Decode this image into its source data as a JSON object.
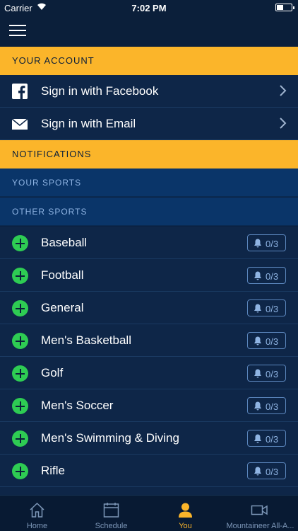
{
  "status_bar": {
    "carrier": "Carrier",
    "time": "7:02 PM"
  },
  "account": {
    "header": "YOUR ACCOUNT",
    "facebook_label": "Sign in with Facebook",
    "email_label": "Sign in with Email"
  },
  "notifications": {
    "header": "NOTIFICATIONS",
    "your_sports_header": "YOUR SPORTS",
    "other_sports_header": "OTHER SPORTS"
  },
  "sports": [
    {
      "name": "Baseball",
      "count": "0/3"
    },
    {
      "name": "Football",
      "count": "0/3"
    },
    {
      "name": "General",
      "count": "0/3"
    },
    {
      "name": "Men's Basketball",
      "count": "0/3"
    },
    {
      "name": "Golf",
      "count": "0/3"
    },
    {
      "name": "Men's Soccer",
      "count": "0/3"
    },
    {
      "name": "Men's Swimming & Diving",
      "count": "0/3"
    },
    {
      "name": "Rifle",
      "count": "0/3"
    }
  ],
  "tabs": [
    {
      "label": "Home",
      "icon": "home-icon"
    },
    {
      "label": "Schedule",
      "icon": "calendar-icon"
    },
    {
      "label": "You",
      "icon": "person-icon",
      "active": true
    },
    {
      "label": "Mountaineer All-A...",
      "icon": "video-icon"
    }
  ],
  "colors": {
    "accent": "#fbb52a",
    "background": "#0b2040",
    "row": "#0e2648",
    "sub_header": "#0a3569",
    "add_green": "#2ecc53"
  }
}
